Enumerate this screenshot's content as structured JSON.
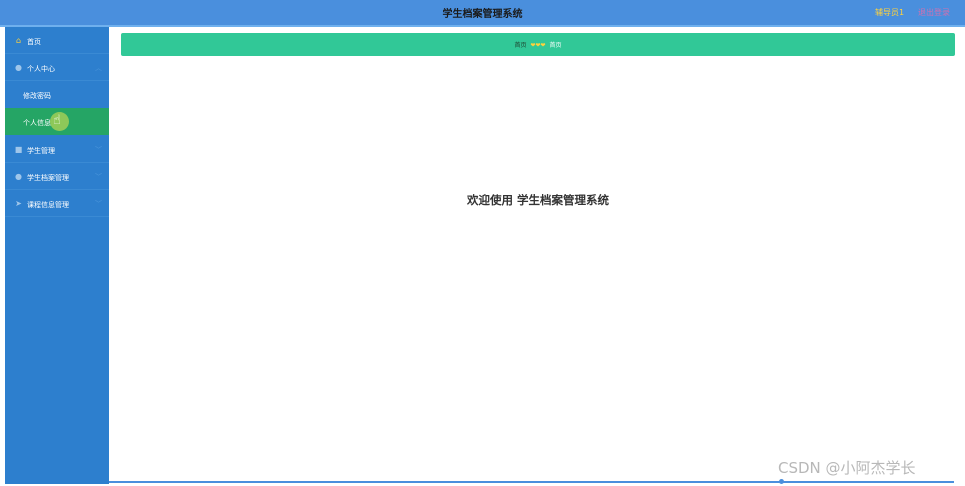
{
  "header": {
    "title": "学生档案管理系统",
    "user": "辅导员1",
    "logout": "退出登录"
  },
  "sidebar": {
    "items": [
      {
        "label": "首页",
        "icon": "home-icon"
      },
      {
        "label": "个人中心",
        "icon": "user-icon"
      },
      {
        "label": "修改密码"
      },
      {
        "label": "个人信息"
      },
      {
        "label": "学生管理",
        "icon": "student-icon"
      },
      {
        "label": "学生档案管理",
        "icon": "user-icon"
      },
      {
        "label": "课程信息管理",
        "icon": "send-icon"
      }
    ]
  },
  "breadcrumb": {
    "first": "首页",
    "separator": "❤❤❤",
    "second": "首页"
  },
  "main": {
    "welcome": "欢迎使用 学生档案管理系统"
  },
  "watermark": "CSDN @小阿杰学长",
  "colors": {
    "header": "#4a8fdd",
    "sidebar": "#2d7fce",
    "active": "#25a565",
    "breadcrumb_bar": "#31c897"
  }
}
